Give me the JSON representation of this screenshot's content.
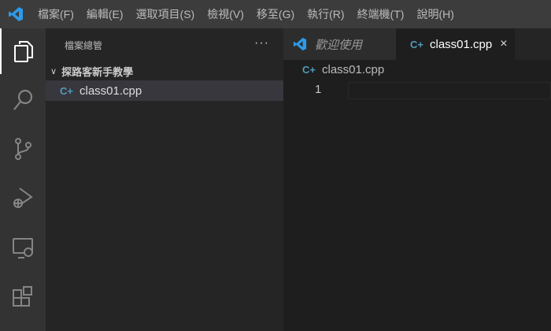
{
  "menu": [
    "檔案(F)",
    "編輯(E)",
    "選取項目(S)",
    "檢視(V)",
    "移至(G)",
    "執行(R)",
    "終端機(T)",
    "說明(H)"
  ],
  "sidebar": {
    "title": "檔案總管",
    "more": "···",
    "folder": "探路客新手教學",
    "files": [
      {
        "name": "class01.cpp"
      }
    ]
  },
  "tabs": [
    {
      "label": "歡迎使用"
    },
    {
      "label": "class01.cpp",
      "close": "×"
    }
  ],
  "breadcrumb": "class01.cpp",
  "editor": {
    "line_numbers": [
      "1"
    ]
  },
  "colors": {
    "accent": "#0078d4",
    "cpp_icon": "#519aba"
  }
}
